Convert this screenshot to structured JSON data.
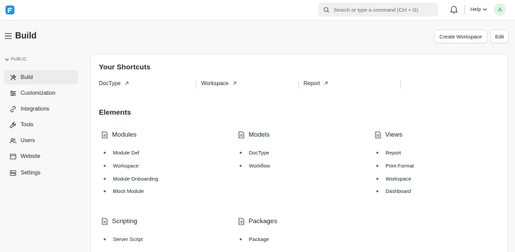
{
  "navbar": {
    "search_placeholder": "Search or type a command (Ctrl + G)",
    "help_label": "Help",
    "avatar_initial": "A"
  },
  "page": {
    "title": "Build",
    "create_workspace_label": "Create Workspace",
    "edit_label": "Edit"
  },
  "sidebar": {
    "section_label": "PUBLIC",
    "items": [
      {
        "label": "Build",
        "icon": "tools-icon"
      },
      {
        "label": "Customization",
        "icon": "sliders-icon"
      },
      {
        "label": "Integrations",
        "icon": "link-icon"
      },
      {
        "label": "Tools",
        "icon": "wrench-icon"
      },
      {
        "label": "Users",
        "icon": "users-icon"
      },
      {
        "label": "Website",
        "icon": "browser-icon"
      },
      {
        "label": "Settings",
        "icon": "settings-icon"
      }
    ]
  },
  "shortcuts": {
    "heading": "Your Shortcuts",
    "items": [
      {
        "label": "DocType"
      },
      {
        "label": "Workspace"
      },
      {
        "label": "Report"
      }
    ]
  },
  "elements": {
    "heading": "Elements",
    "cards": [
      {
        "title": "Modules",
        "links": [
          "Module Def",
          "Workspace",
          "Module Onboarding",
          "Block Module"
        ]
      },
      {
        "title": "Models",
        "links": [
          "DocType",
          "Workflow"
        ]
      },
      {
        "title": "Views",
        "links": [
          "Report",
          "Print Format",
          "Workspace",
          "Dashboard"
        ]
      },
      {
        "title": "Scripting",
        "links": [
          "Server Script"
        ]
      },
      {
        "title": "Packages",
        "links": [
          "Package"
        ]
      }
    ]
  },
  "colors": {
    "brand": "#2490ef",
    "avatar_bg": "#dff5e6",
    "avatar_text": "#2c9a55",
    "active_item_bg": "#ececec"
  }
}
